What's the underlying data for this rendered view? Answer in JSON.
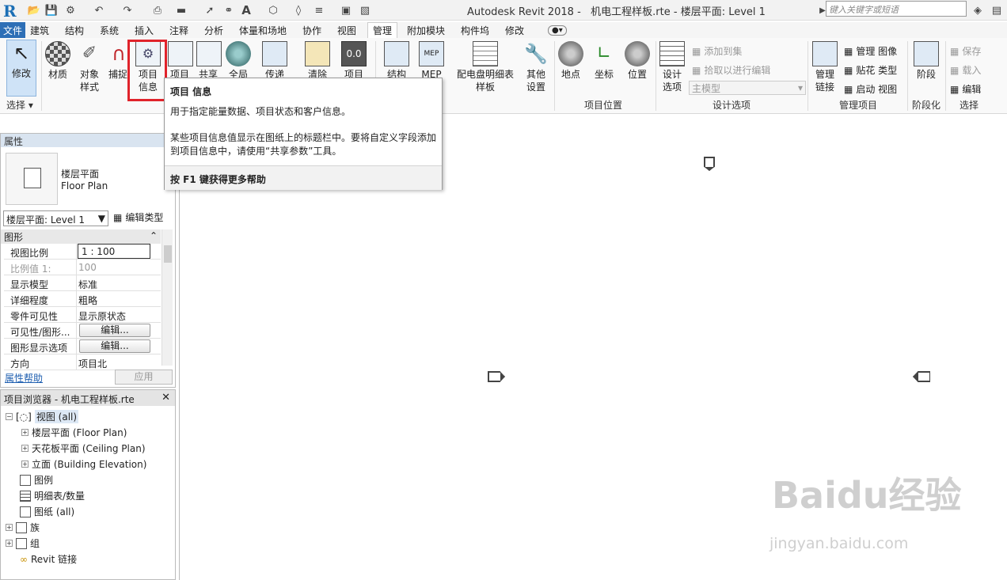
{
  "title_bar": {
    "app_title": "Autodesk Revit 2018 -",
    "doc_title": "机电工程样板.rte - 楼层平面: Level 1",
    "search_placeholder": "键入关键字或短语"
  },
  "tabs": [
    {
      "label": "文件"
    },
    {
      "label": "建筑"
    },
    {
      "label": "结构"
    },
    {
      "label": "系统"
    },
    {
      "label": "插入"
    },
    {
      "label": "注释"
    },
    {
      "label": "分析"
    },
    {
      "label": "体量和场地"
    },
    {
      "label": "协作"
    },
    {
      "label": "视图"
    },
    {
      "label": "管理"
    },
    {
      "label": "附加模块"
    },
    {
      "label": "构件坞"
    },
    {
      "label": "修改"
    }
  ],
  "ribbon": {
    "modify": "修改",
    "select_panel": "选择",
    "material": "材质",
    "object_style_1": "对象",
    "object_style_2": "样式",
    "snap": "捕捉",
    "project_info_1": "项目",
    "project_info_2": "信息",
    "item_4": "项目",
    "item_5": "共享",
    "item_6": "全局",
    "item_7": "传递",
    "item_8": "清除",
    "item_9": "项目",
    "structure": "结构",
    "mep": "MEP",
    "panel_schedule_1": "配电盘明细表",
    "panel_schedule_2": "样板",
    "other_settings_1": "其他",
    "other_settings_2": "设置",
    "location": "地点",
    "coordinates": "坐标",
    "position": "位置",
    "project_location_panel": "项目位置",
    "design_options_1": "设计",
    "design_options_2": "选项",
    "add_to_set": "添加到集",
    "pick_to_edit": "拾取以进行编辑",
    "main_model": "主模型",
    "design_options_panel": "设计选项",
    "manage_links_1": "管理",
    "manage_links_2": "链接",
    "manage_images": "管理 图像",
    "decal_types": "贴花 类型",
    "starting_view": "启动 视图",
    "manage_project_panel": "管理项目",
    "phases": "阶段",
    "phasing_panel": "阶段化",
    "save": "保存",
    "load": "载入",
    "edit": "编辑",
    "selection_panel": "选择"
  },
  "tooltip": {
    "title": "项目 信息",
    "line1": "用于指定能量数据、项目状态和客户信息。",
    "line2": "某些项目信息值显示在图纸上的标题栏中。要将自定义字段添加到项目信息中，请使用“共享参数”工具。",
    "footer": "按 F1 键获得更多帮助"
  },
  "properties": {
    "header": "属性",
    "type_name_cn": "楼层平面",
    "type_name_en": "Floor Plan",
    "selector": "楼层平面: Level 1",
    "edit_type": "编辑类型",
    "group_graphics": "图形",
    "rows": [
      {
        "key": "视图比例",
        "value": "1 : 100"
      },
      {
        "key": "比例值 1:",
        "value": "100"
      },
      {
        "key": "显示模型",
        "value": "标准"
      },
      {
        "key": "详细程度",
        "value": "粗略"
      },
      {
        "key": "零件可见性",
        "value": "显示原状态"
      },
      {
        "key": "可见性/图形...",
        "value": "编辑..."
      },
      {
        "key": "图形显示选项",
        "value": "编辑..."
      },
      {
        "key": "方向",
        "value": "项目北"
      }
    ],
    "help_link": "属性帮助",
    "apply": "应用"
  },
  "browser": {
    "header": "项目浏览器 - 机电工程样板.rte",
    "items": [
      {
        "label": "视图 (all)"
      },
      {
        "label": "楼层平面 (Floor Plan)"
      },
      {
        "label": "天花板平面 (Ceiling Plan)"
      },
      {
        "label": "立面 (Building Elevation)"
      },
      {
        "label": "图例"
      },
      {
        "label": "明细表/数量"
      },
      {
        "label": "图纸 (all)"
      },
      {
        "label": "族"
      },
      {
        "label": "组"
      },
      {
        "label": "Revit 链接"
      }
    ]
  },
  "watermark": {
    "main": "Baidu经验",
    "sub": "jingyan.baidu.com"
  },
  "colors": {
    "accent": "#2e6fb6",
    "highlight": "#e0232b"
  }
}
